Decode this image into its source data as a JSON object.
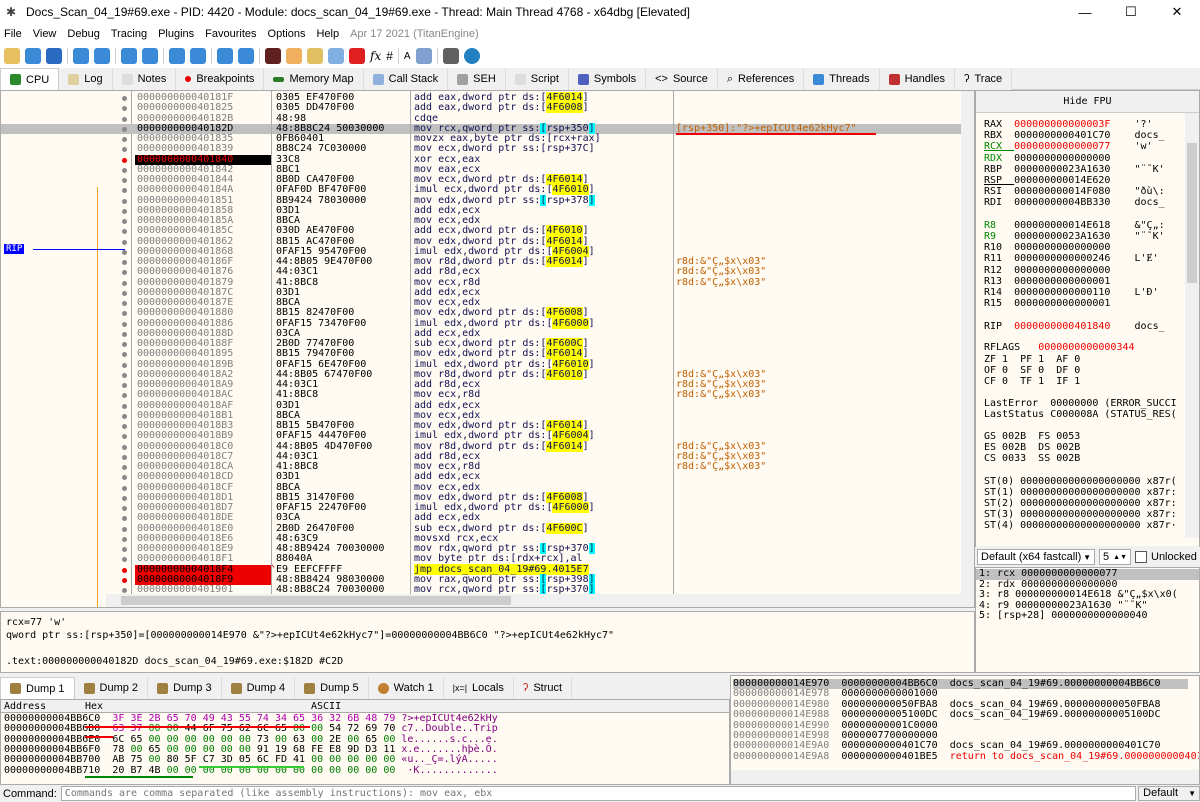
{
  "title": "Docs_Scan_04_19#69.exe - PID: 4420 - Module: docs_scan_04_19#69.exe - Thread: Main Thread 4768 - x64dbg [Elevated]",
  "menu": [
    "File",
    "View",
    "Debug",
    "Tracing",
    "Plugins",
    "Favourites",
    "Options",
    "Help"
  ],
  "version": "Apr 17 2021 (TitanEngine)",
  "tabs": [
    "CPU",
    "Log",
    "Notes",
    "Breakpoints",
    "Memory Map",
    "Call Stack",
    "SEH",
    "Script",
    "Symbols",
    "Source",
    "References",
    "Threads",
    "Handles",
    "Trace"
  ],
  "rip_label": "RIP",
  "disasm": [
    [
      "000000000040181F",
      "0305 EF470F00",
      "add eax,dword ptr ds:[4F6014]",
      ""
    ],
    [
      "0000000000401825",
      "0305 DD470F00",
      "add eax,dword ptr ds:[4F6008]",
      ""
    ],
    [
      "000000000040182B",
      "48:98",
      "cdqe",
      ""
    ],
    [
      "000000000040182D",
      "48:8B8C24 50030000",
      "mov rcx,qword ptr ss:[rsp+350]",
      "[rsp+350]:\"?>+epICUt4e62kHyc7\""
    ],
    [
      "0000000000401835",
      "0FB60401",
      "movzx eax,byte ptr ds:[rcx+rax]",
      ""
    ],
    [
      "0000000000401839",
      "8B8C24 7C030000",
      "mov ecx,dword ptr ss:[rsp+37C]",
      ""
    ],
    [
      "0000000000401840",
      "33C8",
      "xor ecx,eax",
      ""
    ],
    [
      "0000000000401842",
      "8BC1",
      "mov eax,ecx",
      ""
    ],
    [
      "0000000000401844",
      "8B0D CA470F00",
      "mov ecx,dword ptr ds:[4F6014]",
      ""
    ],
    [
      "000000000040184A",
      "0FAF0D BF470F00",
      "imul ecx,dword ptr ds:[4F6010]",
      ""
    ],
    [
      "0000000000401851",
      "8B9424 78030000",
      "mov edx,dword ptr ss:[rsp+378]",
      ""
    ],
    [
      "0000000000401858",
      "03D1",
      "add edx,ecx",
      ""
    ],
    [
      "000000000040185A",
      "8BCA",
      "mov ecx,edx",
      ""
    ],
    [
      "000000000040185C",
      "030D AE470F00",
      "add ecx,dword ptr ds:[4F6010]",
      ""
    ],
    [
      "0000000000401862",
      "8B15 AC470F00",
      "mov edx,dword ptr ds:[4F6014]",
      ""
    ],
    [
      "0000000000401868",
      "0FAF15 95470F00",
      "imul edx,dword ptr ds:[4F6004]",
      ""
    ],
    [
      "000000000040186F",
      "44:8B05 9E470F00",
      "mov r8d,dword ptr ds:[4F6014]",
      "r8d:&\"Ç„$x\\x03\""
    ],
    [
      "0000000000401876",
      "44:03C1",
      "add r8d,ecx",
      "r8d:&\"Ç„$x\\x03\""
    ],
    [
      "0000000000401879",
      "41:8BC8",
      "mov ecx,r8d",
      "r8d:&\"Ç„$x\\x03\""
    ],
    [
      "000000000040187C",
      "03D1",
      "add edx,ecx",
      ""
    ],
    [
      "000000000040187E",
      "8BCA",
      "mov ecx,edx",
      ""
    ],
    [
      "0000000000401880",
      "8B15 82470F00",
      "mov edx,dword ptr ds:[4F6008]",
      ""
    ],
    [
      "0000000000401886",
      "0FAF15 73470F00",
      "imul edx,dword ptr ds:[4F6000]",
      ""
    ],
    [
      "000000000040188D",
      "03CA",
      "add ecx,edx",
      ""
    ],
    [
      "000000000040188F",
      "2B0D 77470F00",
      "sub ecx,dword ptr ds:[4F600C]",
      ""
    ],
    [
      "0000000000401895",
      "8B15 79470F00",
      "mov edx,dword ptr ds:[4F6014]",
      ""
    ],
    [
      "000000000040189B",
      "0FAF15 6E470F00",
      "imul edx,dword ptr ds:[4F6010]",
      ""
    ],
    [
      "00000000004018A2",
      "44:8B05 67470F00",
      "mov r8d,dword ptr ds:[4F6010]",
      "r8d:&\"Ç„$x\\x03\""
    ],
    [
      "00000000004018A9",
      "44:03C1",
      "add r8d,ecx",
      "r8d:&\"Ç„$x\\x03\""
    ],
    [
      "00000000004018AC",
      "41:8BC8",
      "mov ecx,r8d",
      "r8d:&\"Ç„$x\\x03\""
    ],
    [
      "00000000004018AF",
      "03D1",
      "add edx,ecx",
      ""
    ],
    [
      "00000000004018B1",
      "8BCA",
      "mov ecx,edx",
      ""
    ],
    [
      "00000000004018B3",
      "8B15 5B470F00",
      "mov edx,dword ptr ds:[4F6014]",
      ""
    ],
    [
      "00000000004018B9",
      "0FAF15 44470F00",
      "imul edx,dword ptr ds:[4F6004]",
      ""
    ],
    [
      "00000000004018C0",
      "44:8B05 4D470F00",
      "mov r8d,dword ptr ds:[4F6014]",
      "r8d:&\"Ç„$x\\x03\""
    ],
    [
      "00000000004018C7",
      "44:03C1",
      "add r8d,ecx",
      "r8d:&\"Ç„$x\\x03\""
    ],
    [
      "00000000004018CA",
      "41:8BC8",
      "mov ecx,r8d",
      "r8d:&\"Ç„$x\\x03\""
    ],
    [
      "00000000004018CD",
      "03D1",
      "add edx,ecx",
      ""
    ],
    [
      "00000000004018CF",
      "8BCA",
      "mov ecx,edx",
      ""
    ],
    [
      "00000000004018D1",
      "8B15 31470F00",
      "mov edx,dword ptr ds:[4F6008]",
      ""
    ],
    [
      "00000000004018D7",
      "0FAF15 22470F00",
      "imul edx,dword ptr ds:[4F6000]",
      ""
    ],
    [
      "00000000004018DE",
      "03CA",
      "add ecx,edx",
      ""
    ],
    [
      "00000000004018E0",
      "2B0D 26470F00",
      "sub ecx,dword ptr ds:[4F600C]",
      ""
    ],
    [
      "00000000004018E6",
      "48:63C9",
      "movsxd rcx,ecx",
      ""
    ],
    [
      "00000000004018E9",
      "48:8B9424 70030000",
      "mov rdx,qword ptr ss:[rsp+370]",
      ""
    ],
    [
      "00000000004018F1",
      "88040A",
      "mov byte ptr ds:[rdx+rcx],al",
      ""
    ],
    [
      "00000000004018F4",
      "E9 EEFCFFFF",
      "jmp docs_scan_04_19#69.4015E7",
      ""
    ],
    [
      "00000000004018F9",
      "48:8B8424 98030000",
      "mov rax,qword ptr ss:[rsp+398]",
      ""
    ],
    [
      "0000000000401901",
      "48:8B8C24 70030000",
      "mov rcx,qword ptr ss:[rsp+370]",
      ""
    ],
    [
      "0000000000401909",
      "48:8908",
      "mov qword ptr ds:[rax],rcx",
      ""
    ]
  ],
  "selected_row": 3,
  "rip_row": 6,
  "bp_rows": [
    46,
    47
  ],
  "jump_arrow": "^",
  "info": [
    "rcx=77 'w'",
    "qword ptr ss:[rsp+350]=[000000000014E970 &\"?>+epICUt4e62kHyc7\"]=00000000004BB6C0 \"?>+epICUt4e62kHyc7\"",
    "",
    ".text:000000000040182D docs_scan_04_19#69.exe:$182D #C2D"
  ],
  "hide_fpu": "Hide FPU",
  "registers": [
    [
      "RAX",
      "000000000000003F",
      "'?'",
      "red",
      ""
    ],
    [
      "RBX",
      "0000000000401C70",
      "docs_",
      "",
      ""
    ],
    [
      "RCX",
      "0000000000000077",
      "'w'",
      "red",
      "grn"
    ],
    [
      "RDX",
      "0000000000000000",
      "",
      "",
      "grn"
    ],
    [
      "RBP",
      "00000000023A1630",
      "\"¨˜K'",
      "",
      ""
    ],
    [
      "RSP",
      "000000000014E620",
      "",
      "",
      ""
    ],
    [
      "RSI",
      "000000000014F080",
      "\"ðù\\:",
      "",
      ""
    ],
    [
      "RDI",
      "00000000004BB330",
      "docs_",
      "",
      ""
    ],
    [
      "",
      "",
      "",
      "",
      ""
    ],
    [
      "R8",
      "000000000014E618",
      "&\"Ç„:",
      "",
      "grn"
    ],
    [
      "R9",
      "00000000023A1630",
      "\"¨˜K'",
      "",
      "grn"
    ],
    [
      "R10",
      "0000000000000000",
      "",
      "",
      ""
    ],
    [
      "R11",
      "0000000000000246",
      "L'Ɇ'",
      "",
      ""
    ],
    [
      "R12",
      "0000000000000000",
      "",
      "",
      ""
    ],
    [
      "R13",
      "0000000000000001",
      "",
      "",
      ""
    ],
    [
      "R14",
      "0000000000000110",
      "L'Đ'",
      "",
      ""
    ],
    [
      "R15",
      "0000000000000001",
      "",
      "",
      ""
    ],
    [
      "",
      "",
      "",
      "",
      ""
    ],
    [
      "RIP",
      "0000000000401840",
      "docs_",
      "red",
      ""
    ]
  ],
  "rflags": {
    "label": "RFLAGS",
    "value": "0000000000000344"
  },
  "flags": [
    "ZF 1  PF 1  AF 0",
    "OF 0  SF 0  DF 0",
    "CF 0  TF 1  IF 1"
  ],
  "last_error": "LastError  00000000 (ERROR_SUCCI",
  "last_status": "LastStatus C000008A (STATUS_RES(",
  "segs": [
    "GS 002B  FS 0053",
    "ES 002B  DS 002B",
    "CS 0033  SS 002B"
  ],
  "fpu": [
    "ST(0) 00000000000000000000 x87r(",
    "ST(1) 00000000000000000000 x87r:",
    "ST(2) 00000000000000000000 x87r:",
    "ST(3) 00000000000000000000 x87r:",
    "ST(4) 00000000000000000000 x87r·"
  ],
  "callconv": {
    "value": "Default (x64 fastcall)",
    "count": "5",
    "unlocked": "Unlocked"
  },
  "args": [
    "1: rcx 0000000000000077",
    "2: rdx 0000000000000000",
    "3: r8 000000000014E618 &\"Ç„$x\\x0(",
    "4: r9 00000000023A1630 \"¨˜K\"",
    "5: [rsp+28] 0000000000000040"
  ],
  "bottom_tabs": [
    "Dump 1",
    "Dump 2",
    "Dump 3",
    "Dump 4",
    "Dump 5",
    "Watch 1",
    "Locals",
    "Struct"
  ],
  "dump": {
    "headers": [
      "Address",
      "Hex",
      "ASCII"
    ],
    "rows": [
      [
        "00000000004BB6C0",
        "3F 3E 2B 65 70 49 43 55 74 34 65 36 32 6B 48 79",
        "?>+epICUt4e62kHy"
      ],
      [
        "00000000004BB6D0",
        "63 37 00 00 44 6F 75 62 6C 65 00 00 54 72 69 70",
        "c7..Double..Trip"
      ],
      [
        "00000000004BB6E0",
        "6C 65 00 00 00 00 00 00 73 00 63 00 2E 00 65 00",
        "le......s.c...e."
      ],
      [
        "00000000004BB6F0",
        "78 00 65 00 00 00 00 00 91 19 68 FE E8 9D D3 11",
        "x.e.......hþè.Ó."
      ],
      [
        "00000000004BB700",
        "AB 75 00 80 5F C7 3D 05 6C FD 41 00 00 00 00 00",
        "«u.._Ç=.lýA....."
      ],
      [
        "00000000004BB710",
        "20 B7 4B 00 00 00 00 00 00 00 00 00 00 00 00 00",
        " ·K............."
      ]
    ]
  },
  "stack": [
    [
      "000000000014E970",
      "00000000004BB6C0",
      "docs_scan_04_19#69.00000000004BB6C0"
    ],
    [
      "000000000014E978",
      "0000000000001000",
      ""
    ],
    [
      "000000000014E980",
      "000000000050FBA8",
      "docs_scan_04_19#69.000000000050FBA8"
    ],
    [
      "000000000014E988",
      "00000000005100DC",
      "docs_scan_04_19#69.00000000005100DC"
    ],
    [
      "000000000014E990",
      "00000000001C0000",
      ""
    ],
    [
      "000000000014E998",
      "0000007700000000",
      ""
    ],
    [
      "000000000014E9A0",
      "0000000000401C70",
      "docs_scan_04_19#69.0000000000401C70"
    ],
    [
      "000000000014E9A8",
      "0000000000401BE5",
      "return to docs_scan_04_19#69.0000000000401BE5"
    ]
  ],
  "command": {
    "label": "Command:",
    "placeholder": "Commands are comma separated (like assembly instructions): mov eax, ebx",
    "mode": "Default"
  }
}
